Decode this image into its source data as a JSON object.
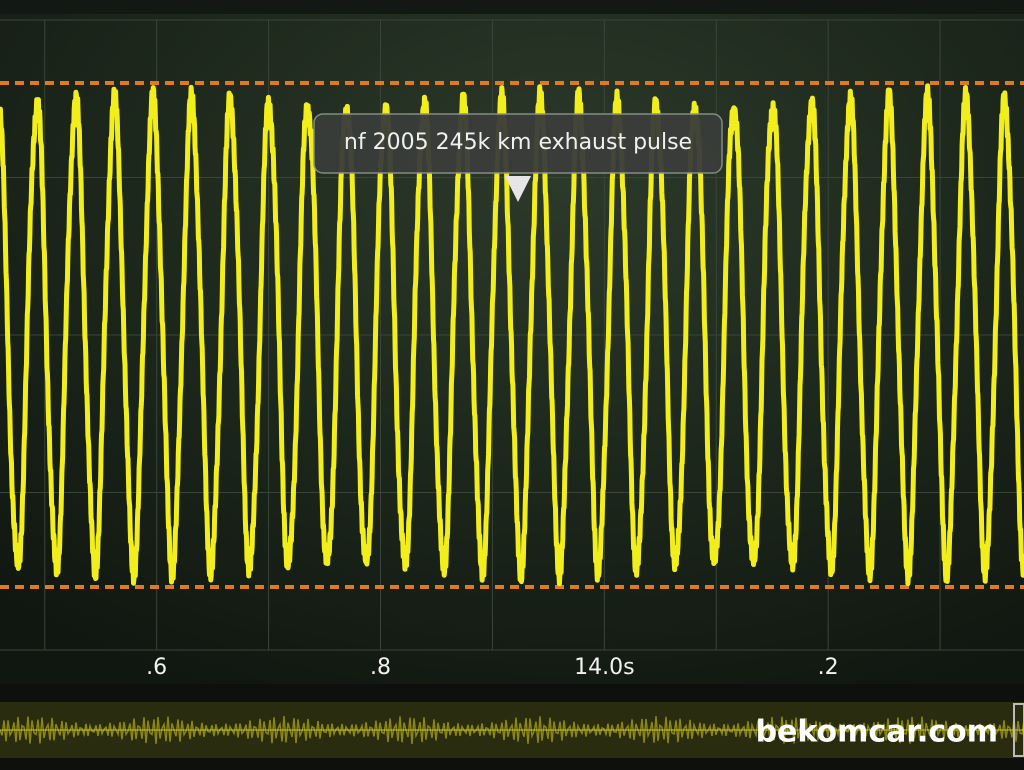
{
  "chart_data": {
    "type": "line",
    "title": "",
    "xlabel": "",
    "ylabel": "",
    "x_tick_labels": [
      ".6",
      ".8",
      "14.0s",
      ".2"
    ],
    "x_ticks": [
      13.6,
      13.8,
      14.0,
      14.2
    ],
    "xlim": [
      13.46,
      14.375
    ],
    "ylim": [
      -1.25,
      1.25
    ],
    "grid": true,
    "annotation": "nf 2005 245k km exhaust pulse",
    "reference_lines": [
      1,
      -1
    ],
    "series": [
      {
        "name": "",
        "period": 0.0346,
        "amplitude": 0.92,
        "color": "#f2ee1c"
      }
    ]
  },
  "colors": {
    "background": "#1c261b",
    "trace": "#f2ee1c",
    "reference": "#e07a1e",
    "grid": "#3a4539"
  },
  "watermark": "bekomcar.com"
}
